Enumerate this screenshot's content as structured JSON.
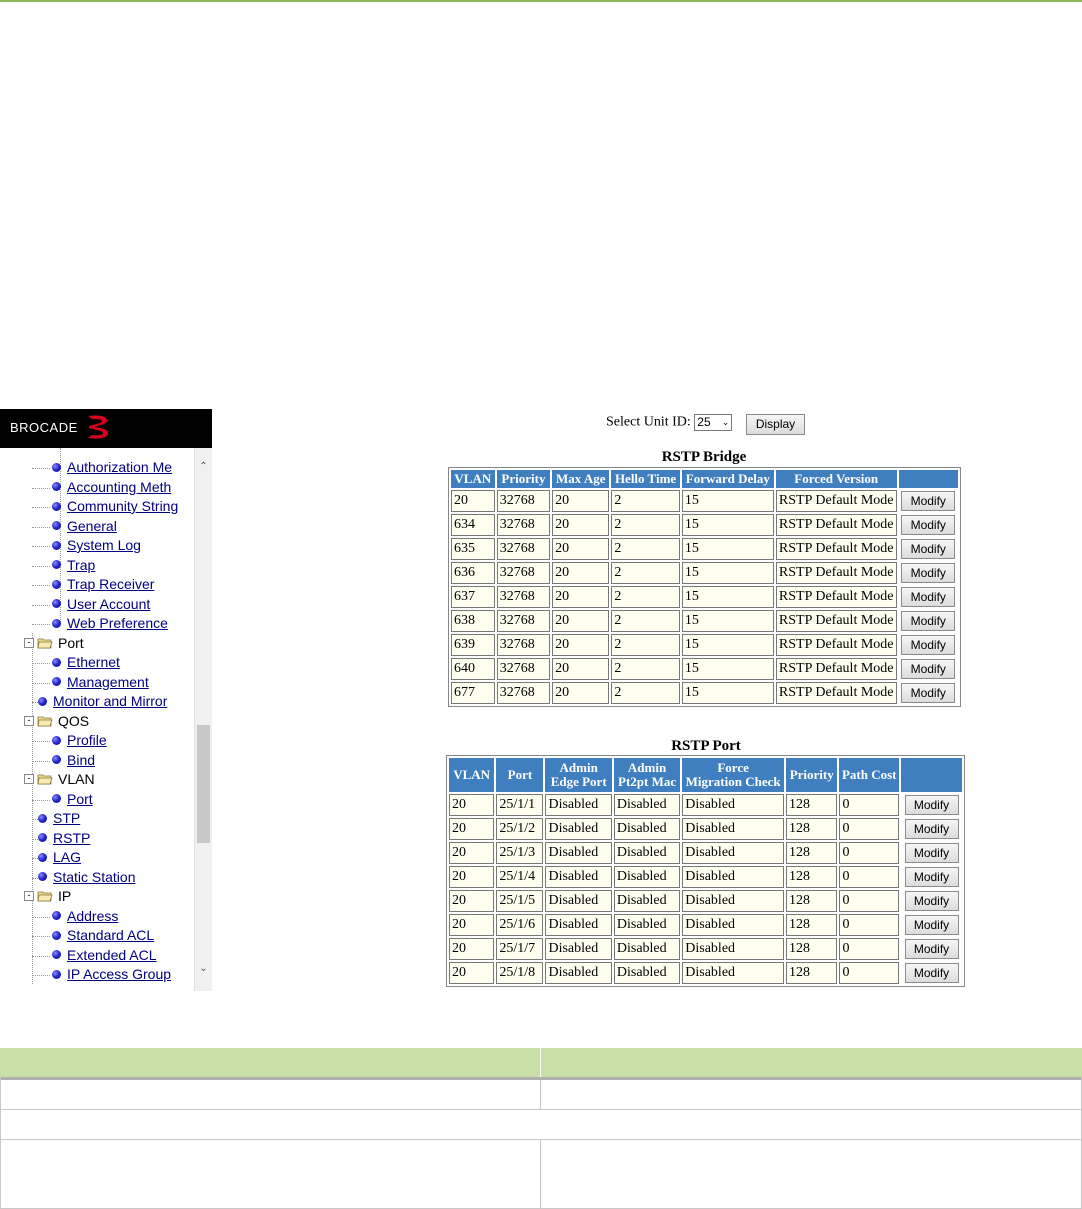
{
  "brand": {
    "name": "BROCADE"
  },
  "sidebar": {
    "items": [
      {
        "label": "Authorization Me",
        "type": "leaf",
        "indent": 2
      },
      {
        "label": "Accounting Meth",
        "type": "leaf",
        "indent": 2
      },
      {
        "label": "Community String",
        "type": "leaf",
        "indent": 2
      },
      {
        "label": "General",
        "type": "leaf",
        "indent": 2
      },
      {
        "label": "System Log",
        "type": "leaf",
        "indent": 2
      },
      {
        "label": "Trap",
        "type": "leaf",
        "indent": 2
      },
      {
        "label": "Trap Receiver",
        "type": "leaf",
        "indent": 2
      },
      {
        "label": "User Account",
        "type": "leaf",
        "indent": 2
      },
      {
        "label": "Web Preference",
        "type": "leaf",
        "indent": 2
      },
      {
        "label": "Port",
        "type": "folder",
        "indent": 1
      },
      {
        "label": "Ethernet",
        "type": "leaf",
        "indent": 2
      },
      {
        "label": "Management",
        "type": "leaf",
        "indent": 2
      },
      {
        "label": "Monitor and Mirror",
        "type": "leaf",
        "indent": 1
      },
      {
        "label": "QOS",
        "type": "folder",
        "indent": 1
      },
      {
        "label": "Profile",
        "type": "leaf",
        "indent": 2
      },
      {
        "label": "Bind",
        "type": "leaf",
        "indent": 2
      },
      {
        "label": "VLAN",
        "type": "folder",
        "indent": 1
      },
      {
        "label": "Port",
        "type": "leaf",
        "indent": 2
      },
      {
        "label": "STP",
        "type": "leaf",
        "indent": 1
      },
      {
        "label": "RSTP",
        "type": "leaf",
        "indent": 1
      },
      {
        "label": "LAG",
        "type": "leaf",
        "indent": 1
      },
      {
        "label": "Static Station",
        "type": "leaf",
        "indent": 1
      },
      {
        "label": "IP",
        "type": "folder",
        "indent": 1
      },
      {
        "label": "Address",
        "type": "leaf",
        "indent": 2
      },
      {
        "label": "Standard ACL",
        "type": "leaf",
        "indent": 2
      },
      {
        "label": "Extended ACL",
        "type": "leaf",
        "indent": 2
      },
      {
        "label": "IP Access Group",
        "type": "leaf",
        "indent": 2
      }
    ]
  },
  "unit_select": {
    "label": "Select Unit ID:",
    "value": "25",
    "button": "Display"
  },
  "bridge": {
    "caption": "RSTP Bridge",
    "headers": [
      "VLAN",
      "Priority",
      "Max Age",
      "Hello Time",
      "Forward Delay",
      "Forced Version",
      ""
    ],
    "button_label": "Modify",
    "rows": [
      [
        "20",
        "32768",
        "20",
        "2",
        "15",
        "RSTP Default Mode"
      ],
      [
        "634",
        "32768",
        "20",
        "2",
        "15",
        "RSTP Default Mode"
      ],
      [
        "635",
        "32768",
        "20",
        "2",
        "15",
        "RSTP Default Mode"
      ],
      [
        "636",
        "32768",
        "20",
        "2",
        "15",
        "RSTP Default Mode"
      ],
      [
        "637",
        "32768",
        "20",
        "2",
        "15",
        "RSTP Default Mode"
      ],
      [
        "638",
        "32768",
        "20",
        "2",
        "15",
        "RSTP Default Mode"
      ],
      [
        "639",
        "32768",
        "20",
        "2",
        "15",
        "RSTP Default Mode"
      ],
      [
        "640",
        "32768",
        "20",
        "2",
        "15",
        "RSTP Default Mode"
      ],
      [
        "677",
        "32768",
        "20",
        "2",
        "15",
        "RSTP Default Mode"
      ]
    ]
  },
  "port": {
    "caption": "RSTP Port",
    "headers": [
      "VLAN",
      "Port",
      "Admin\nEdge Port",
      "Admin\nPt2pt Mac",
      "Force\nMigration Check",
      "Priority",
      "Path Cost",
      ""
    ],
    "button_label": "Modify",
    "rows": [
      [
        "20",
        "25/1/1",
        "Disabled",
        "Disabled",
        "Disabled",
        "128",
        "0"
      ],
      [
        "20",
        "25/1/2",
        "Disabled",
        "Disabled",
        "Disabled",
        "128",
        "0"
      ],
      [
        "20",
        "25/1/3",
        "Disabled",
        "Disabled",
        "Disabled",
        "128",
        "0"
      ],
      [
        "20",
        "25/1/4",
        "Disabled",
        "Disabled",
        "Disabled",
        "128",
        "0"
      ],
      [
        "20",
        "25/1/5",
        "Disabled",
        "Disabled",
        "Disabled",
        "128",
        "0"
      ],
      [
        "20",
        "25/1/6",
        "Disabled",
        "Disabled",
        "Disabled",
        "128",
        "0"
      ],
      [
        "20",
        "25/1/7",
        "Disabled",
        "Disabled",
        "Disabled",
        "128",
        "0"
      ],
      [
        "20",
        "25/1/8",
        "Disabled",
        "Disabled",
        "Disabled",
        "128",
        "0"
      ]
    ]
  },
  "colors": {
    "header_blue": "#3f7fbf",
    "cell_bg": "#fffff0",
    "doc_header_green": "#c8e0a8",
    "top_rule_green": "#8dbb5a"
  }
}
